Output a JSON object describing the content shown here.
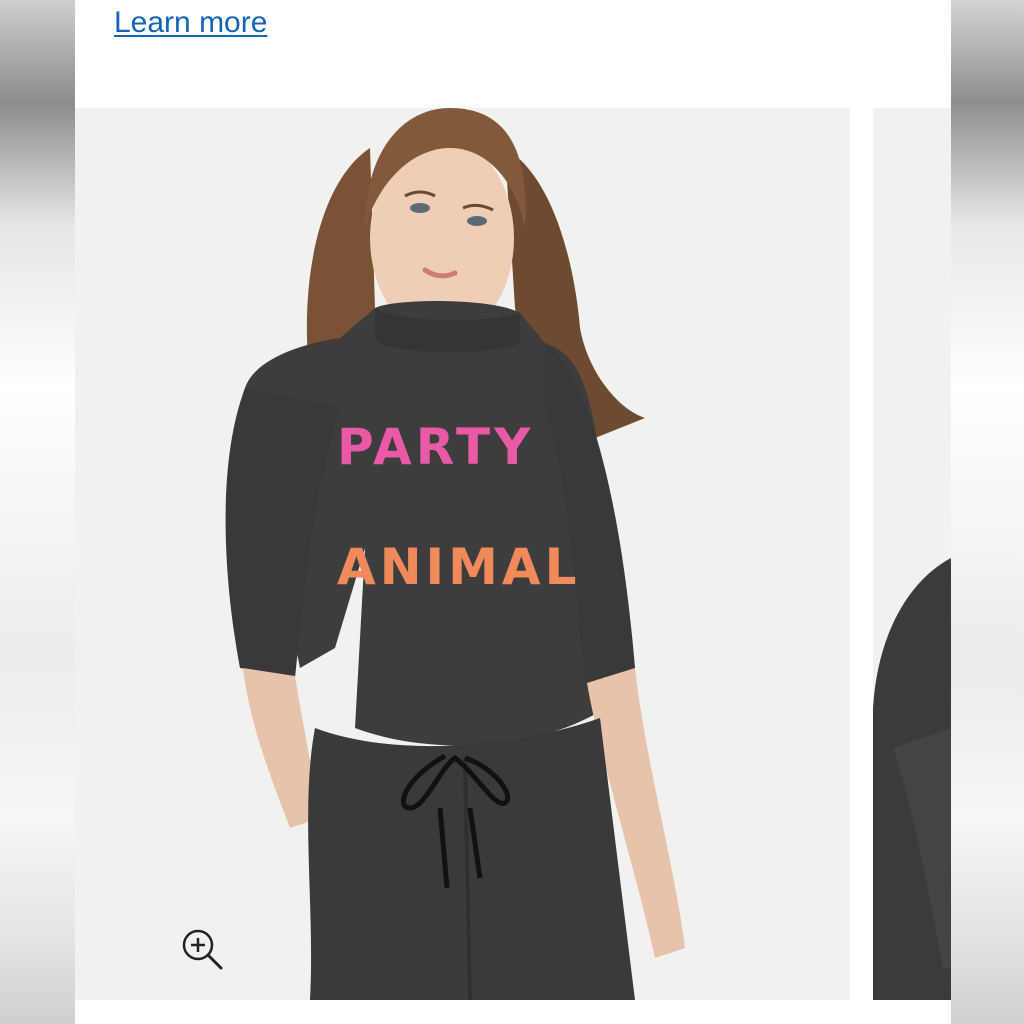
{
  "header": {
    "learn_more_link": "Learn more"
  },
  "gallery": {
    "main_image_alt": "Model wearing a dark grey mock neck sweater with PARTY ANIMAL lettering and matching joggers",
    "sweater_text_line1": "PARTY",
    "sweater_text_line2": "ANIMAL",
    "zoom_icon": "zoom-in-icon"
  },
  "colors": {
    "link": "#1565b6",
    "image_background": "#f1f1f0",
    "sweater": "#3d3d3e",
    "pants": "#3a3a3d"
  }
}
